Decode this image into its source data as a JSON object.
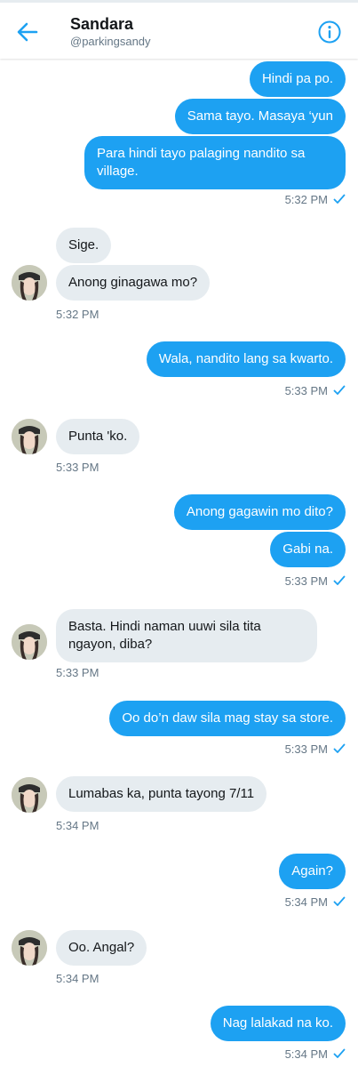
{
  "header": {
    "name": "Sandara",
    "handle": "@parkingsandy",
    "back_icon": "arrow-left-icon",
    "info_icon": "info-icon"
  },
  "colors": {
    "accent": "#1da1f2",
    "incoming": "#e6ecf0",
    "meta": "#657786"
  },
  "messages": [
    {
      "dir": "out",
      "text": "Hindi pa po."
    },
    {
      "dir": "out",
      "text": "Sama tayo. Masaya ‘yun"
    },
    {
      "dir": "out",
      "text": "Para hindi tayo palaging nandito sa village.",
      "time": "5:32 PM"
    },
    {
      "dir": "in",
      "text": "Sige."
    },
    {
      "dir": "in",
      "text": "Anong ginagawa mo?",
      "time": "5:32 PM"
    },
    {
      "dir": "out",
      "text": "Wala, nandito lang sa kwarto.",
      "time": "5:33 PM"
    },
    {
      "dir": "in",
      "text": "Punta 'ko.",
      "time": "5:33 PM"
    },
    {
      "dir": "out",
      "text": "Anong gagawin mo dito?"
    },
    {
      "dir": "out",
      "text": "Gabi na.",
      "time": "5:33 PM"
    },
    {
      "dir": "in",
      "text": "Basta. Hindi naman uuwi sila tita ngayon, diba?",
      "time": "5:33 PM"
    },
    {
      "dir": "out",
      "text": "Oo do’n daw sila mag stay sa store.",
      "time": "5:33 PM"
    },
    {
      "dir": "in",
      "text": "Lumabas ka, punta tayong 7/11",
      "time": "5:34 PM"
    },
    {
      "dir": "out",
      "text": "Again?",
      "time": "5:34 PM"
    },
    {
      "dir": "in",
      "text": "Oo. Angal?",
      "time": "5:34 PM"
    },
    {
      "dir": "out",
      "text": "Nag lalakad na ko.",
      "time": "5:34 PM"
    }
  ]
}
